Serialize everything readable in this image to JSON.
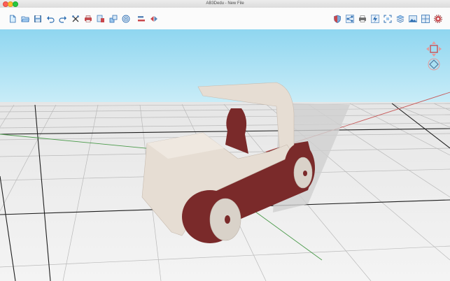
{
  "window": {
    "title": "AB3Dedu - New File"
  },
  "toolbar": {
    "left_tools": [
      "new-file-icon",
      "open-file-icon",
      "save-file-icon",
      "undo-icon",
      "redo-icon",
      "tools-icon",
      "print-icon",
      "import-icon",
      "group-icon",
      "target-icon",
      "align-icon",
      "mirror-icon"
    ],
    "right_tools": [
      "shield-icon",
      "share-icon",
      "printer-icon",
      "lightning-icon",
      "fit-view-icon",
      "layers-icon",
      "render-icon",
      "grid-icon",
      "settings-icon"
    ]
  },
  "colors": {
    "sky_top": "#8fd6f0",
    "sky_bottom": "#cdeef8",
    "floor": "#ececec",
    "accent": "#d23b3b",
    "body_wood": "#e6ddd3",
    "dark_wood": "#7a2a2a"
  }
}
